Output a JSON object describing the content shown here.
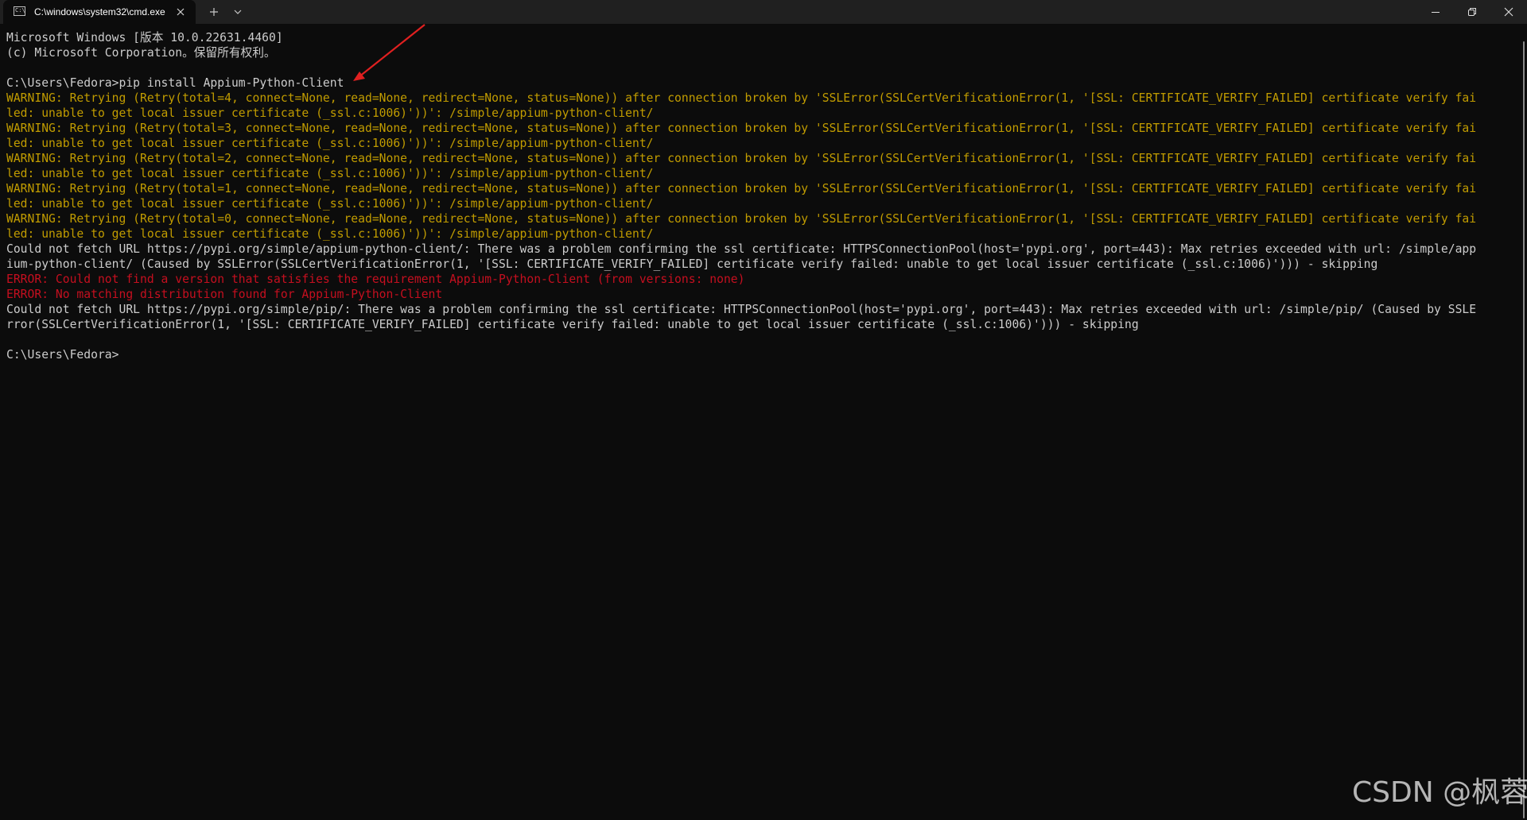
{
  "window": {
    "tab_title": "C:\\windows\\system32\\cmd.exe",
    "tab_icon": "cmd-icon",
    "tab_icon_text": "C:\\",
    "buttons": {
      "new_tab": "plus-icon",
      "dropdown": "chevron-down-icon",
      "minimize": "minimize-icon",
      "maximize": "restore-icon",
      "close": "close-icon"
    }
  },
  "colors": {
    "background": "#0c0c0c",
    "text": "#cccccc",
    "warning": "#c19c00",
    "error": "#c50f1f",
    "annotation_arrow": "#e02020"
  },
  "console": {
    "lines": [
      {
        "text": "Microsoft Windows [版本 10.0.22631.4460]",
        "type": "normal"
      },
      {
        "text": "(c) Microsoft Corporation。保留所有权利。",
        "type": "normal"
      },
      {
        "text": "",
        "type": "normal"
      },
      {
        "text": "C:\\Users\\Fedora>pip install Appium-Python-Client",
        "type": "normal"
      },
      {
        "text": "WARNING: Retrying (Retry(total=4, connect=None, read=None, redirect=None, status=None)) after connection broken by 'SSLError(SSLCertVerificationError(1, '[SSL: CERTIFICATE_VERIFY_FAILED] certificate verify fai",
        "type": "warn"
      },
      {
        "text": "led: unable to get local issuer certificate (_ssl.c:1006)'))': /simple/appium-python-client/",
        "type": "warn"
      },
      {
        "text": "WARNING: Retrying (Retry(total=3, connect=None, read=None, redirect=None, status=None)) after connection broken by 'SSLError(SSLCertVerificationError(1, '[SSL: CERTIFICATE_VERIFY_FAILED] certificate verify fai",
        "type": "warn"
      },
      {
        "text": "led: unable to get local issuer certificate (_ssl.c:1006)'))': /simple/appium-python-client/",
        "type": "warn"
      },
      {
        "text": "WARNING: Retrying (Retry(total=2, connect=None, read=None, redirect=None, status=None)) after connection broken by 'SSLError(SSLCertVerificationError(1, '[SSL: CERTIFICATE_VERIFY_FAILED] certificate verify fai",
        "type": "warn"
      },
      {
        "text": "led: unable to get local issuer certificate (_ssl.c:1006)'))': /simple/appium-python-client/",
        "type": "warn"
      },
      {
        "text": "WARNING: Retrying (Retry(total=1, connect=None, read=None, redirect=None, status=None)) after connection broken by 'SSLError(SSLCertVerificationError(1, '[SSL: CERTIFICATE_VERIFY_FAILED] certificate verify fai",
        "type": "warn"
      },
      {
        "text": "led: unable to get local issuer certificate (_ssl.c:1006)'))': /simple/appium-python-client/",
        "type": "warn"
      },
      {
        "text": "WARNING: Retrying (Retry(total=0, connect=None, read=None, redirect=None, status=None)) after connection broken by 'SSLError(SSLCertVerificationError(1, '[SSL: CERTIFICATE_VERIFY_FAILED] certificate verify fai",
        "type": "warn"
      },
      {
        "text": "led: unable to get local issuer certificate (_ssl.c:1006)'))': /simple/appium-python-client/",
        "type": "warn"
      },
      {
        "text": "Could not fetch URL https://pypi.org/simple/appium-python-client/: There was a problem confirming the ssl certificate: HTTPSConnectionPool(host='pypi.org', port=443): Max retries exceeded with url: /simple/app",
        "type": "normal"
      },
      {
        "text": "ium-python-client/ (Caused by SSLError(SSLCertVerificationError(1, '[SSL: CERTIFICATE_VERIFY_FAILED] certificate verify failed: unable to get local issuer certificate (_ssl.c:1006)'))) - skipping",
        "type": "normal"
      },
      {
        "text": "ERROR: Could not find a version that satisfies the requirement Appium-Python-Client (from versions: none)",
        "type": "err"
      },
      {
        "text": "ERROR: No matching distribution found for Appium-Python-Client",
        "type": "err"
      },
      {
        "text": "Could not fetch URL https://pypi.org/simple/pip/: There was a problem confirming the ssl certificate: HTTPSConnectionPool(host='pypi.org', port=443): Max retries exceeded with url: /simple/pip/ (Caused by SSLE",
        "type": "normal"
      },
      {
        "text": "rror(SSLCertVerificationError(1, '[SSL: CERTIFICATE_VERIFY_FAILED] certificate verify failed: unable to get local issuer certificate (_ssl.c:1006)'))) - skipping",
        "type": "normal"
      },
      {
        "text": "",
        "type": "normal"
      },
      {
        "text": "C:\\Users\\Fedora>",
        "type": "normal"
      }
    ]
  },
  "watermark": "CSDN @枫蓉"
}
